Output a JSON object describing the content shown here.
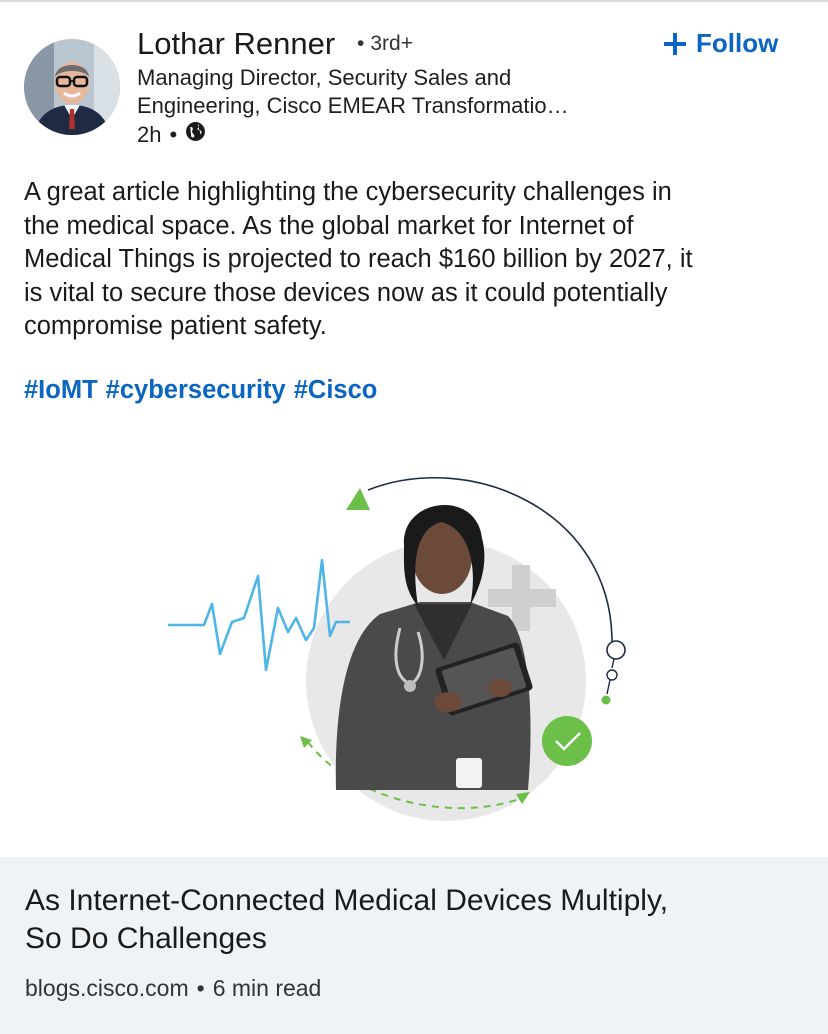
{
  "post": {
    "author": {
      "name": "Lothar Renner",
      "degree": "3rd+",
      "headline_line1": "Managing Director, Security Sales and",
      "headline_line2": "Engineering, Cisco EMEAR Transformatio…",
      "time": "2h",
      "visibility_icon": "globe-icon"
    },
    "follow_label": "Follow",
    "text_lines": [
      "A great article highlighting the cybersecurity challenges in",
      "the medical space. As the global market for Internet of",
      "Medical Things is projected to reach $160 billion by 2027, it",
      "is vital to secure those devices now as it could potentially",
      "compromise patient safety."
    ],
    "hashtags": [
      "#IoMT",
      "#cybersecurity",
      "#Cisco"
    ]
  },
  "article": {
    "title_line1": "As Internet-Connected Medical Devices Multiply,",
    "title_line2": "So Do Challenges",
    "source": "blogs.cisco.com",
    "read_time": "6 min read"
  },
  "colors": {
    "link_blue": "#0a66c2",
    "heartbeat_blue": "#4db6e6",
    "accent_green": "#6cc04a",
    "footer_bg": "#eef3f8"
  }
}
